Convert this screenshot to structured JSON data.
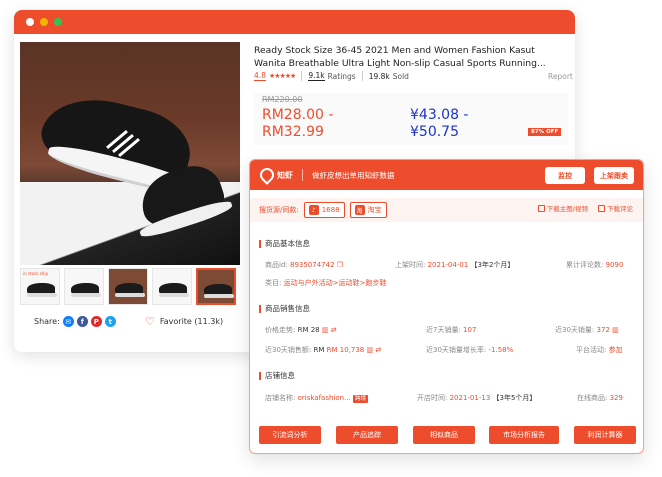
{
  "colors": {
    "brand": "#ee4d2d",
    "usd": "#1b35c8"
  },
  "product": {
    "title": "Ready Stock Size 36-45 2021 Men and Women Fashion Kasut Wanita Breathable Ultra Light Non-slip Casual Sports Running...",
    "rating": "4.8",
    "stars": "★★★★★",
    "ratings_count": "9.1k",
    "ratings_label": "Ratings",
    "sold_count": "19.8k",
    "sold_label": "Sold",
    "report": "Report",
    "old_price": "RM220.00",
    "rm_price": "RM28.00 - RM32.99",
    "usd_price": "¥43.08 - ¥50.75",
    "discount": "87% OFF",
    "share_label": "Share:",
    "share_icons": [
      "messenger-icon",
      "facebook-icon",
      "pinterest-icon",
      "twitter-icon"
    ],
    "favorite": "Favorite (11.3k)",
    "thumb_tag": "in stock ship"
  },
  "plugin": {
    "logo": "知虾",
    "slogan": "做虾皮想出单用知虾数据",
    "btn_monitor": "监控",
    "btn_shelf": "上架跟卖",
    "source_label": "搜货源/同款:",
    "src1": "1688",
    "src2": "淘宝",
    "download_media": "下载主图/视频",
    "download_reviews": "下载评论",
    "sec1": "商品基本信息",
    "sec2": "商品销售信息",
    "sec3": "店铺信息",
    "basic": {
      "id_label": "商品id:",
      "id_value": "8935074742",
      "listed_label": "上架时间:",
      "listed_value": "2021-04-01",
      "listed_span": "【3年2个月】",
      "reviews_label": "累计评论数:",
      "reviews_value": "9090",
      "category_label": "类目:",
      "category_value": "运动与户外活动>运动鞋>跑步鞋"
    },
    "sales": {
      "trend_label": "价格走势:",
      "trend_value": "RM 28",
      "sales7_label": "近7天销量:",
      "sales7_value": "107",
      "sales30_label": "近30天销量:",
      "sales30_value": "372",
      "rev30_label": "近30天销售额:",
      "rev30_value": "RM 10,738",
      "growth_label": "近30天销量增长率:",
      "growth_value": "-1.58%",
      "activity_label": "平台活动:",
      "activity_value": "参加"
    },
    "shop": {
      "name_label": "店铺名称:",
      "name_value": "oriskafashion...",
      "name_tag": "跨境",
      "open_label": "开店时间:",
      "open_value": "2021-01-13",
      "open_span": "【3年5个月】",
      "online_label": "在线商品:",
      "online_value": "329"
    },
    "footer": [
      "引流词分析",
      "产品追踪",
      "相似商品",
      "市场分析报告",
      "利润计算器"
    ]
  }
}
